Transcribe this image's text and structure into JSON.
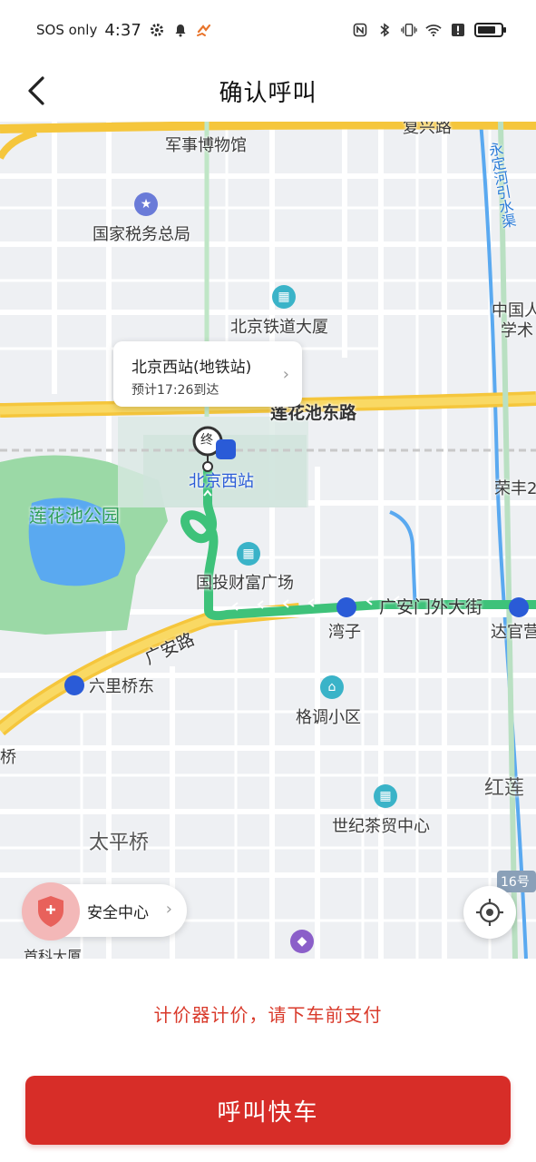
{
  "status_bar": {
    "sos_text": "SOS only",
    "time": "4:37",
    "battery_level": 0.8
  },
  "header": {
    "title": "确认呼叫"
  },
  "map": {
    "callout": {
      "title": "北京西站(地铁站)",
      "eta": "预计17:26到达"
    },
    "end_marker_text": "终",
    "labels": {
      "military_museum": "军事博物馆",
      "tax_bureau": "国家税务总局",
      "railway_building": "北京铁道大厦",
      "lianhuachi_east_rd": "莲花池东路",
      "beijing_west_station": "北京西站",
      "lianhuachi_park": "莲花池公园",
      "guotou_plaza": "国投财富广场",
      "guanganmen_wai_st": "广安门外大街",
      "wanzi": "湾子",
      "guanan_rd": "广安路",
      "liuliqiao_east": "六里桥东",
      "gediao_district": "格调小区",
      "hongglian": "红莲",
      "century_tea_center": "世纪茶贸中心",
      "taipingqiao": "太平桥",
      "shouke_building": "首科大厦",
      "dagaungyuan": "达官营",
      "rongfeng": "荣丰2",
      "zhongguo_renmin": "中国人",
      "xueshu": "学术",
      "yongding_canal": "永定河引水渠",
      "road_16": "16号",
      "qiao": "桥",
      "fuxing": "复兴路"
    },
    "safety_center_label": "安全中心"
  },
  "fare_note": "计价器计价，请下车前支付",
  "call_button_label": "呼叫快车",
  "colors": {
    "accent": "#d72d28",
    "fare_note": "#d93a2b",
    "route": "#3ec27a",
    "road_main": "#f5c63c",
    "water": "#5aa9f0",
    "park": "#9bd9a6"
  }
}
